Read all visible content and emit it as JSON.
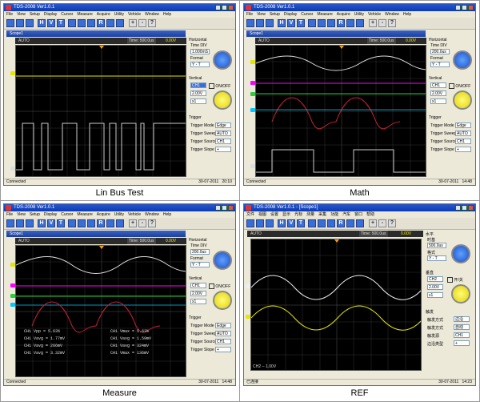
{
  "captions": [
    "Lin Bus Test",
    "Math",
    "Measure",
    "REF"
  ],
  "app": {
    "title": "TDS-2008 Ver1.0.1",
    "title_cn": "TDS-2008 Ver1.0.1 - [Scope1]",
    "menu": [
      "File",
      "View",
      "Setup",
      "Display",
      "Cursor",
      "Measure",
      "Acquire",
      "Utility",
      "Vehicle",
      "Window",
      "Help"
    ],
    "menu_cn": [
      "文件",
      "视图",
      "设置",
      "显示",
      "光标",
      "测量",
      "采集",
      "功能",
      "汽车",
      "窗口",
      "帮助"
    ],
    "scope_tab": "Scope1",
    "status_left": "Connected",
    "status_left_cn": "已连接",
    "date": "30-07-2011",
    "times": [
      "20:10",
      "14:48",
      "14:48",
      "14:23"
    ],
    "mode": "AUTO",
    "trigger_time": "Time: 500.0us",
    "trigger_volts": "0.00V"
  },
  "panel": {
    "horizontal": "Horizontal",
    "time_div_label": "Time DIV",
    "time_div_values": [
      "1.000mS",
      "200.0us",
      "200.0us"
    ],
    "format_label": "Format",
    "format_value": "Y - T",
    "vertical": "Vertical",
    "channel": "CH1",
    "onoff": "ON/OFF",
    "volt_value": "2.00V",
    "coupling": "x1",
    "trigger": "Trigger",
    "trigger_mode_label": "Trigger Mode",
    "trigger_mode": "Edge",
    "trigger_sweep_label": "Trigger Sweep",
    "trigger_sweep": "AUTO",
    "trigger_source_label": "Trigger Source",
    "trigger_source": "CH1",
    "trigger_slope_label": "Trigger Slope",
    "trigger_slope": "+"
  },
  "panel_cn": {
    "horizontal": "水平",
    "time_div_label": "时基",
    "time_div_value": "500.0us",
    "format_label": "格式",
    "format_value": "Y - T",
    "vertical": "垂直",
    "channel": "CH2",
    "onoff": "开/关",
    "trigger": "触发",
    "trigger_mode_label": "触发方式",
    "trigger_mode": "边沿",
    "trigger_sweep_label": "触发方式",
    "trigger_sweep": "自动",
    "trigger_source_label": "触发源",
    "trigger_source": "CH1",
    "trigger_slope_label": "边沿类型",
    "trigger_slope": "+",
    "ch_status": "CH2 -- 1.00V"
  },
  "measurements": [
    [
      "CH1 Vpp = 5.63%",
      "CH1 Vmax = 5.63%"
    ],
    [
      "CH1 Vavg = 1.77mV",
      "CH1 Vavg = 1.59mV"
    ],
    [
      "CH1 Vavg = 266mV",
      "CH1 Vavg = 324mV"
    ],
    [
      "CH1 Vavg = 3.32mV",
      "CH1 Vmax = 136mV"
    ]
  ],
  "colors": {
    "ch_yellow": "#e6e600",
    "ch_pink": "#ff00ff",
    "ch_green": "#2ecc40",
    "ch_cyan": "#00c8ff",
    "ch_red": "#c0203a",
    "ch_white": "#e0e0e0"
  }
}
